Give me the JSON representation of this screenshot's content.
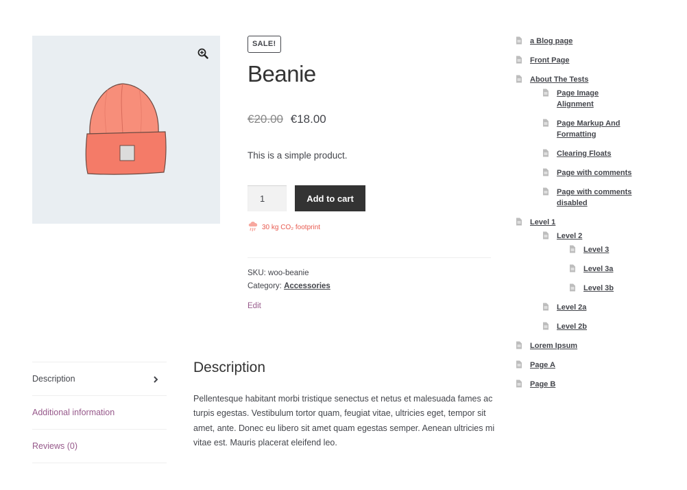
{
  "product": {
    "sale_badge": "SALE!",
    "title": "Beanie",
    "regular_price": "€20.00",
    "sale_price": "€18.00",
    "short_description": "This is a simple product.",
    "quantity": "1",
    "add_to_cart_label": "Add to cart",
    "co2_footprint": "30 kg CO₂ footprint",
    "sku_label": "SKU:",
    "sku_value": "woo-beanie",
    "category_label": "Category:",
    "category_value": "Accessories",
    "edit_label": "Edit"
  },
  "tabs": [
    {
      "label": "Description",
      "active": true
    },
    {
      "label": "Additional information",
      "active": false
    },
    {
      "label": "Reviews (0)",
      "active": false
    }
  ],
  "description_panel": {
    "heading": "Description",
    "body": "Pellentesque habitant morbi tristique senectus et netus et malesuada fames ac turpis egestas. Vestibulum tortor quam, feugiat vitae, ultricies eget, tempor sit amet, ante. Donec eu libero sit amet quam egestas semper. Aenean ultricies mi vitae est. Mauris placerat eleifend leo."
  },
  "sidebar_pages": {
    "blog": "a Blog page",
    "front": "Front Page",
    "about": "About The Tests",
    "about_children": [
      "Page Image Alignment",
      "Page Markup And Formatting",
      "Clearing Floats",
      "Page with comments",
      "Page with comments disabled"
    ],
    "level1": "Level 1",
    "level2": "Level 2",
    "level3": "Level 3",
    "level3a": "Level 3a",
    "level3b": "Level 3b",
    "level2a": "Level 2a",
    "level2b": "Level 2b",
    "lorem": "Lorem Ipsum",
    "pageA": "Page A",
    "pageB": "Page B"
  },
  "icons": {
    "zoom": "magnifier-plus-icon",
    "page": "page-icon",
    "co2": "cloud-rain-icon",
    "chevron": "chevron-right-icon"
  },
  "colors": {
    "accent": "#96588a",
    "button": "#333333",
    "co2": "#e85a4f",
    "gallery_bg": "#e9eef2"
  }
}
